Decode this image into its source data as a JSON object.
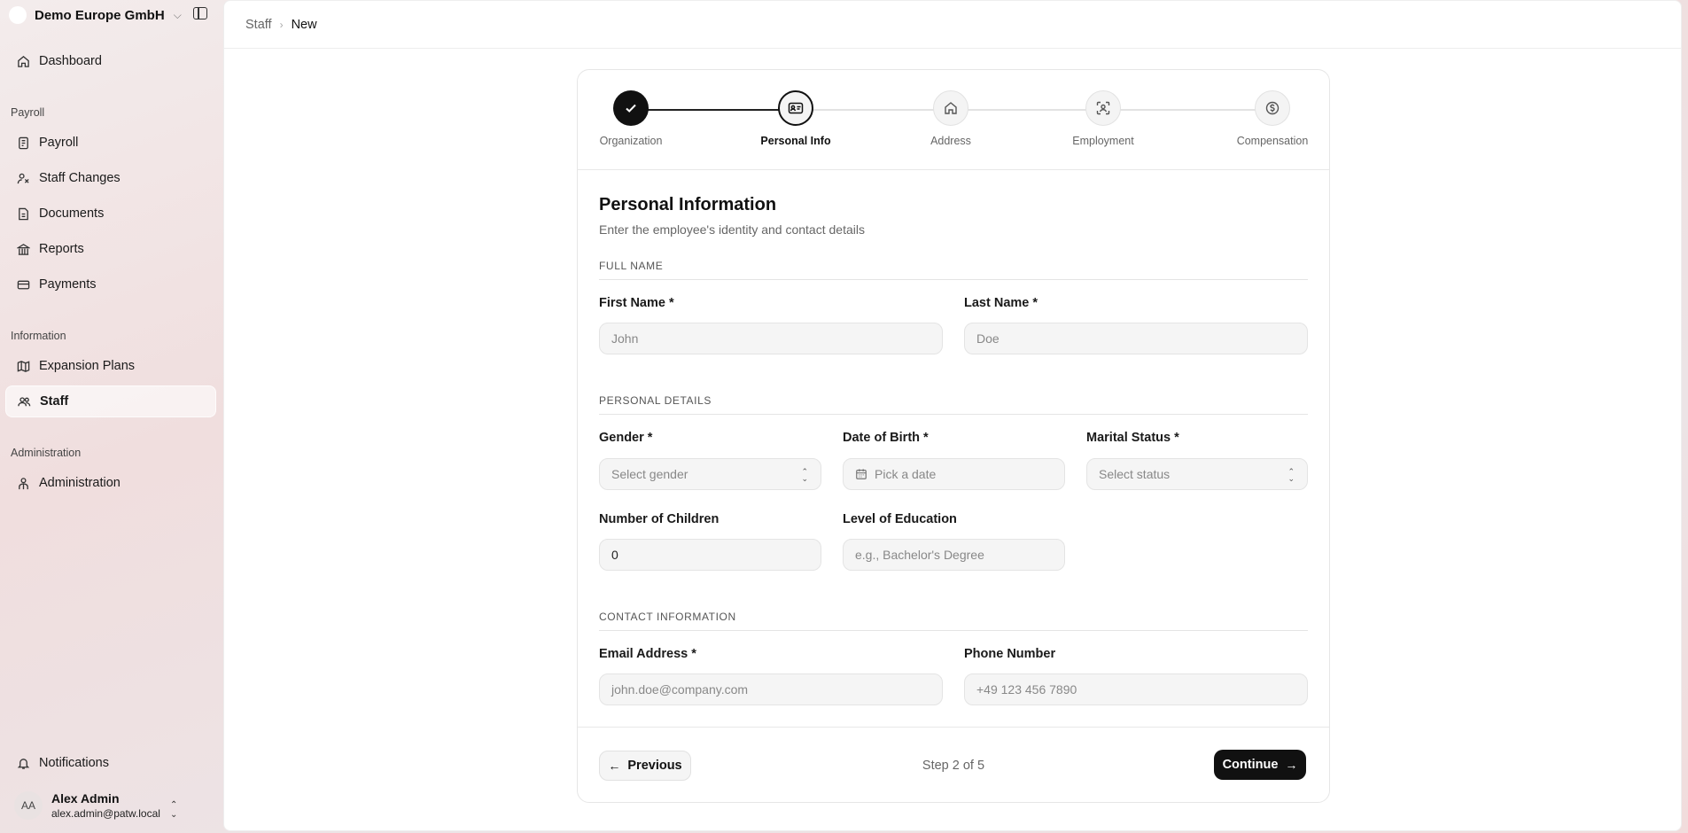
{
  "sidebar": {
    "org_name": "Demo Europe GmbH",
    "nav_top": [
      {
        "label": "Dashboard",
        "icon": "home-icon"
      }
    ],
    "sections": [
      {
        "label": "Payroll",
        "items": [
          {
            "label": "Payroll",
            "icon": "receipt-icon"
          },
          {
            "label": "Staff Changes",
            "icon": "user-change-icon"
          },
          {
            "label": "Documents",
            "icon": "document-icon"
          },
          {
            "label": "Reports",
            "icon": "bank-icon"
          },
          {
            "label": "Payments",
            "icon": "credit-card-icon"
          }
        ]
      },
      {
        "label": "Information",
        "items": [
          {
            "label": "Expansion Plans",
            "icon": "map-icon"
          },
          {
            "label": "Staff",
            "icon": "users-icon",
            "active": true
          }
        ]
      },
      {
        "label": "Administration",
        "items": [
          {
            "label": "Administration",
            "icon": "admin-user-icon"
          }
        ]
      }
    ],
    "notifications_label": "Notifications",
    "user": {
      "initials": "AA",
      "name": "Alex Admin",
      "email": "alex.admin@patw.local"
    }
  },
  "breadcrumb": {
    "parent": "Staff",
    "current": "New"
  },
  "stepper": {
    "steps": [
      {
        "label": "Organization",
        "state": "done",
        "icon": "check-icon"
      },
      {
        "label": "Personal Info",
        "state": "current",
        "icon": "id-card-icon"
      },
      {
        "label": "Address",
        "state": "todo",
        "icon": "home-icon"
      },
      {
        "label": "Employment",
        "state": "todo",
        "icon": "user-scan-icon"
      },
      {
        "label": "Compensation",
        "state": "todo",
        "icon": "dollar-circle-icon"
      }
    ]
  },
  "form": {
    "title": "Personal Information",
    "subtitle": "Enter the employee's identity and contact details",
    "sections": {
      "full_name": "FULL NAME",
      "personal_details": "PERSONAL DETAILS",
      "contact": "CONTACT INFORMATION"
    },
    "fields": {
      "first_name": {
        "label": "First Name *",
        "placeholder": "John"
      },
      "last_name": {
        "label": "Last Name *",
        "placeholder": "Doe"
      },
      "gender": {
        "label": "Gender *",
        "placeholder": "Select gender"
      },
      "dob": {
        "label": "Date of Birth *",
        "placeholder": "Pick a date"
      },
      "marital": {
        "label": "Marital Status *",
        "placeholder": "Select status"
      },
      "children": {
        "label": "Number of Children",
        "value": "0"
      },
      "education": {
        "label": "Level of Education",
        "placeholder": "e.g., Bachelor's Degree"
      },
      "email": {
        "label": "Email Address *",
        "placeholder": "john.doe@company.com"
      },
      "phone": {
        "label": "Phone Number",
        "placeholder": "+49 123 456 7890"
      }
    }
  },
  "footer": {
    "previous_label": "Previous",
    "step_text": "Step 2 of 5",
    "continue_label": "Continue"
  }
}
